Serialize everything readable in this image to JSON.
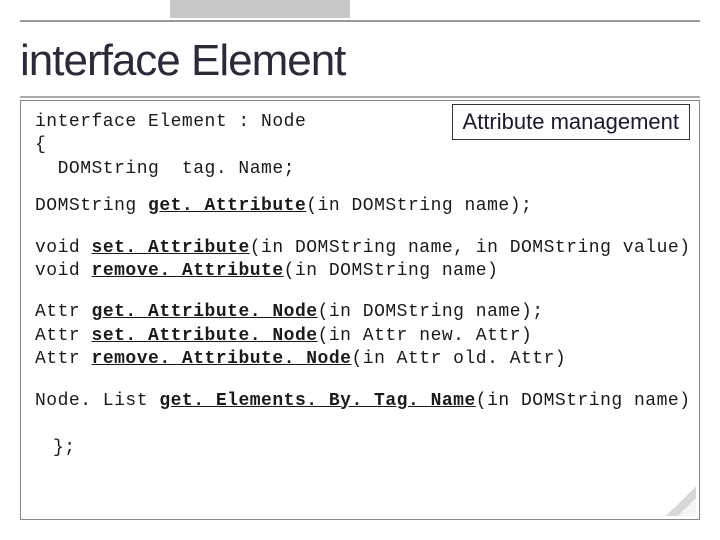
{
  "title": "interface Element",
  "badge": "Attribute management",
  "code": {
    "header1": "interface Element : Node",
    "header2": "{",
    "header3": "  DOMString  tag. Name;",
    "get_attr_pre": "DOMString ",
    "get_attr_method": "get. Attribute",
    "get_attr_post": "(in DOMString name);",
    "set_attr_pre": "void ",
    "set_attr_method": "set. Attribute",
    "set_attr_post": "(in DOMString name, in DOMString value)",
    "rem_attr_pre": "void ",
    "rem_attr_method": "remove. Attribute",
    "rem_attr_post": "(in DOMString name)",
    "gan_pre": "Attr ",
    "gan_method": "get. Attribute. Node",
    "gan_post": "(in DOMString name);",
    "san_pre": "Attr ",
    "san_method": "set. Attribute. Node",
    "san_post": "(in Attr new. Attr)",
    "ran_pre": "Attr ",
    "ran_method": "remove. Attribute. Node",
    "ran_post": "(in Attr old. Attr)",
    "gebt_pre": "Node. List ",
    "gebt_method": "get. Elements. By. Tag. Name",
    "gebt_post": "(in DOMString name)",
    "close": "};"
  }
}
